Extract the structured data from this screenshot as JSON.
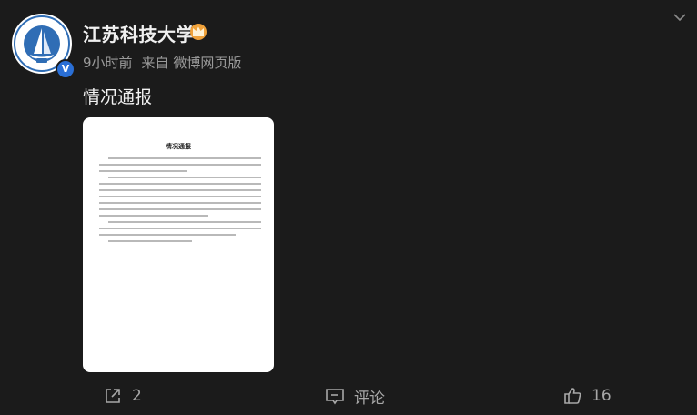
{
  "author": {
    "name": "江苏科技大学",
    "avatar_icon": "university-logo-icon",
    "verified_icon": "verified-badge-icon",
    "badge_icon": "crown-icon"
  },
  "meta": {
    "time": "9小时前",
    "source_prefix": "来自",
    "source": "微博网页版"
  },
  "post": {
    "text": "情况通报",
    "attachment": {
      "title": "情况通报"
    }
  },
  "actions": {
    "share": {
      "icon": "share-icon",
      "count": "2"
    },
    "comment": {
      "icon": "comment-icon",
      "label": "评论"
    },
    "like": {
      "icon": "thumbs-up-icon",
      "count": "16"
    }
  },
  "colors": {
    "background": "#1b1b1b",
    "text_primary": "#f2f2f2",
    "text_secondary": "#9a9a9a",
    "verified_blue": "#2a6fd6",
    "crown_orange": "#f0a23a"
  }
}
